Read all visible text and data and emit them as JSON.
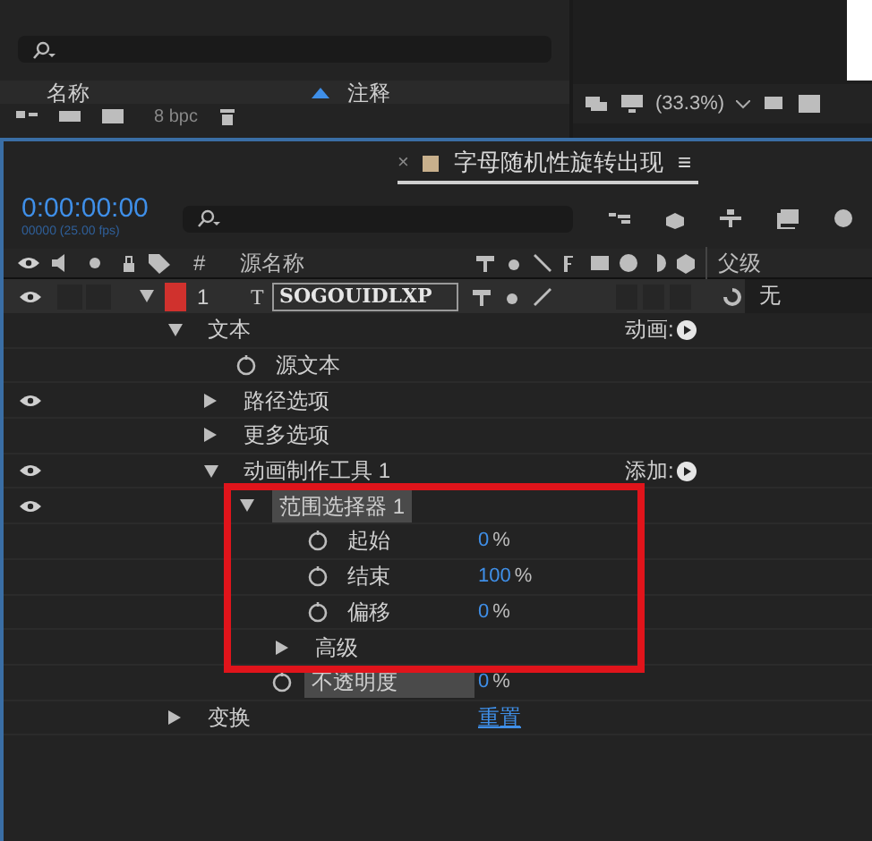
{
  "project_panel": {
    "columns": [
      "名称",
      "注释"
    ],
    "bit_depth": "8 bpc"
  },
  "viewer": {
    "zoom": "(33.3%)"
  },
  "timeline": {
    "tab": {
      "close": "×",
      "title": "字母随机性旋转出现",
      "menu": "≡"
    },
    "timecode": "0:00:00:00",
    "frame_info": "00000 (25.00 fps)",
    "columns": {
      "number": "#",
      "source_name": "源名称",
      "parent": "父级"
    },
    "layer": {
      "number": "1",
      "type": "T",
      "name": "SOGOUIDLXP",
      "parent": "无",
      "visible": true,
      "expanded": true
    },
    "properties": [
      {
        "kind": "group",
        "label": "文本",
        "expanded": true,
        "visible": false,
        "action": "动画:",
        "children": [
          {
            "kind": "property",
            "label": "源文本",
            "visible": false
          },
          {
            "kind": "group",
            "label": "路径选项",
            "expanded": false,
            "visible": true
          },
          {
            "kind": "group",
            "label": "更多选项",
            "expanded": false,
            "visible": false
          },
          {
            "kind": "group",
            "label": "动画制作工具 1",
            "expanded": true,
            "visible": true,
            "action": "添加:",
            "children": [
              {
                "kind": "group",
                "label": "范围选择器 1",
                "expanded": true,
                "visible": true,
                "highlighted": true,
                "children": [
                  {
                    "kind": "property",
                    "label": "起始",
                    "value": "0",
                    "unit": "%",
                    "visible": false
                  },
                  {
                    "kind": "property",
                    "label": "结束",
                    "value": "100",
                    "unit": "%",
                    "visible": false
                  },
                  {
                    "kind": "property",
                    "label": "偏移",
                    "value": "0",
                    "unit": "%",
                    "visible": false
                  },
                  {
                    "kind": "group",
                    "label": "高级",
                    "expanded": false,
                    "visible": false
                  }
                ]
              },
              {
                "kind": "property",
                "label": "不透明度",
                "value": "0",
                "unit": "%",
                "visible": false,
                "highlighted": true
              }
            ]
          }
        ]
      },
      {
        "kind": "group",
        "label": "变换",
        "expanded": false,
        "visible": false,
        "link": "重置"
      }
    ]
  }
}
